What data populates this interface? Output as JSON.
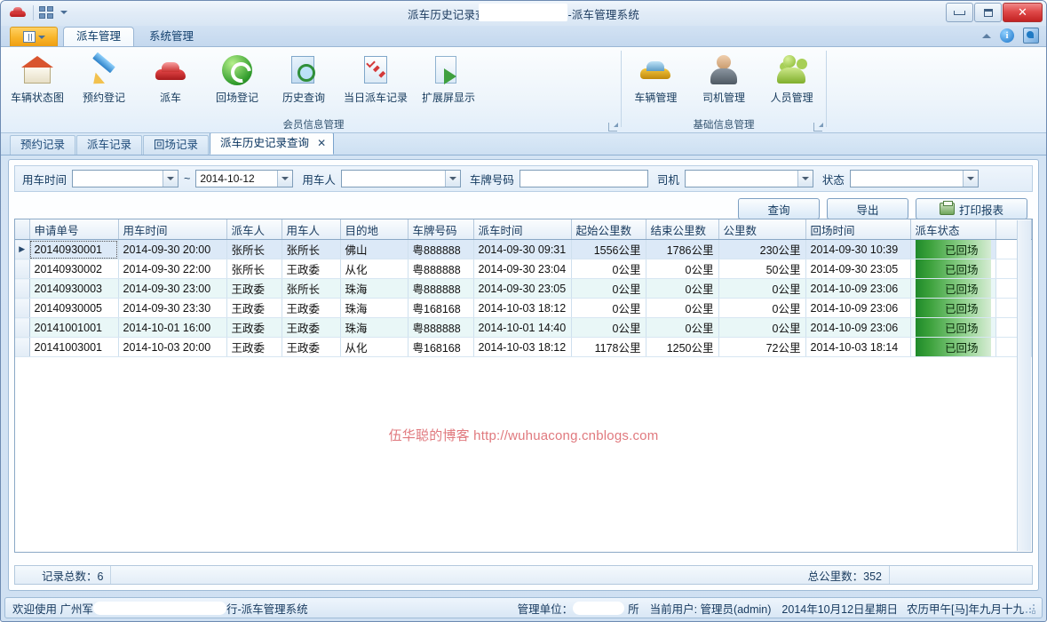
{
  "window": {
    "title": "派车历史记录查询 - 广州军区        行-派车管理系统",
    "title_prefix": "派车历史记录查询 - 广州军区",
    "title_suffix": "行-派车管理系统",
    "minimize_label": "最小化",
    "maximize_label": "最大化",
    "close_label": "✕"
  },
  "quick_access": {
    "app_icon": "car-icon",
    "customize_icon": "grid-icon"
  },
  "ribbon": {
    "app_button_label": "菜单",
    "tabs": [
      {
        "label": "派车管理",
        "active": true
      },
      {
        "label": "系统管理",
        "active": false
      }
    ],
    "right_icons": {
      "collapse": "chevron-up-icon",
      "info": "i",
      "help": "help-icon"
    },
    "groups": [
      {
        "title": "会员信息管理",
        "has_launcher": true,
        "items": [
          {
            "label": "车辆状态图",
            "icon": "house-icon"
          },
          {
            "label": "预约登记",
            "icon": "pencil-icon"
          },
          {
            "label": "派车",
            "icon": "red-car-icon"
          },
          {
            "label": "回场登记",
            "icon": "green-refresh-icon"
          },
          {
            "label": "历史查询",
            "icon": "magnifier-documents-icon"
          },
          {
            "label": "当日派车记录",
            "icon": "checklist-icon"
          },
          {
            "label": "扩展屏显示",
            "icon": "export-document-icon"
          }
        ]
      },
      {
        "title": "基础信息管理",
        "has_launcher": true,
        "items": [
          {
            "label": "车辆管理",
            "icon": "gold-car-icon"
          },
          {
            "label": "司机管理",
            "icon": "person-icon"
          },
          {
            "label": "人员管理",
            "icon": "people-icon"
          }
        ]
      }
    ]
  },
  "doc_tabs": [
    {
      "label": "预约记录",
      "active": false,
      "closable": false
    },
    {
      "label": "派车记录",
      "active": false,
      "closable": false
    },
    {
      "label": "回场记录",
      "active": false,
      "closable": false
    },
    {
      "label": "派车历史记录查询",
      "active": true,
      "closable": true,
      "close_glyph": "✕"
    }
  ],
  "filters": {
    "use_time_label": "用车时间",
    "use_time_from": "",
    "use_time_from_placeholder": "",
    "range_separator": "~",
    "use_time_to": "2014-10-12",
    "user_label": "用车人",
    "user_value": "",
    "plate_label": "车牌号码",
    "plate_value": "",
    "driver_label": "司机",
    "driver_value": "",
    "status_label": "状态",
    "status_value": ""
  },
  "actions": {
    "query": "查询",
    "export": "导出",
    "print": "打印报表",
    "print_icon": "printer-icon"
  },
  "grid": {
    "columns": [
      "申请单号",
      "用车时间",
      "派车人",
      "用车人",
      "目的地",
      "车牌号码",
      "派车时间",
      "起始公里数",
      "结束公里数",
      "公里数",
      "回场时间",
      "派车状态"
    ],
    "rows": [
      {
        "selected": true,
        "indicator": "▶",
        "申请单号": "20140930001",
        "用车时间": "2014-09-30 20:00",
        "派车人": "张所长",
        "用车人": "张所长",
        "目的地": "佛山",
        "车牌号码": "粤888888",
        "派车时间": "2014-09-30 09:31",
        "起始公里数": "1556公里",
        "结束公里数": "1786公里",
        "公里数": "230公里",
        "回场时间": "2014-09-30 10:39",
        "派车状态": "已回场"
      },
      {
        "selected": false,
        "indicator": "",
        "申请单号": "20140930002",
        "用车时间": "2014-09-30 22:00",
        "派车人": "张所长",
        "用车人": "王政委",
        "目的地": "从化",
        "车牌号码": "粤888888",
        "派车时间": "2014-09-30 23:04",
        "起始公里数": "0公里",
        "结束公里数": "0公里",
        "公里数": "50公里",
        "回场时间": "2014-09-30 23:05",
        "派车状态": "已回场"
      },
      {
        "selected": false,
        "indicator": "",
        "申请单号": "20140930003",
        "用车时间": "2014-09-30 23:00",
        "派车人": "王政委",
        "用车人": "张所长",
        "目的地": "珠海",
        "车牌号码": "粤888888",
        "派车时间": "2014-09-30 23:05",
        "起始公里数": "0公里",
        "结束公里数": "0公里",
        "公里数": "0公里",
        "回场时间": "2014-10-09 23:06",
        "派车状态": "已回场"
      },
      {
        "selected": false,
        "indicator": "",
        "申请单号": "20140930005",
        "用车时间": "2014-09-30 23:30",
        "派车人": "王政委",
        "用车人": "王政委",
        "目的地": "珠海",
        "车牌号码": "粤168168",
        "派车时间": "2014-10-03 18:12",
        "起始公里数": "0公里",
        "结束公里数": "0公里",
        "公里数": "0公里",
        "回场时间": "2014-10-09 23:06",
        "派车状态": "已回场"
      },
      {
        "selected": false,
        "indicator": "",
        "申请单号": "20141001001",
        "用车时间": "2014-10-01 16:00",
        "派车人": "王政委",
        "用车人": "王政委",
        "目的地": "珠海",
        "车牌号码": "粤888888",
        "派车时间": "2014-10-01 14:40",
        "起始公里数": "0公里",
        "结束公里数": "0公里",
        "公里数": "0公里",
        "回场时间": "2014-10-09 23:06",
        "派车状态": "已回场"
      },
      {
        "selected": false,
        "indicator": "",
        "申请单号": "20141003001",
        "用车时间": "2014-10-03 20:00",
        "派车人": "王政委",
        "用车人": "王政委",
        "目的地": "从化",
        "车牌号码": "粤168168",
        "派车时间": "2014-10-03 18:12",
        "起始公里数": "1178公里",
        "结束公里数": "1250公里",
        "公里数": "72公里",
        "回场时间": "2014-10-03 18:14",
        "派车状态": "已回场"
      }
    ]
  },
  "watermark": "伍华聪的博客 http://wuhuacong.cnblogs.com",
  "summary": {
    "record_total": "记录总数：6",
    "km_total": "总公里数：352"
  },
  "statusbar": {
    "welcome_prefix": "欢迎使用 广州军",
    "welcome_suffix": "行-派车管理系统",
    "unit_label": "管理单位：",
    "unit_suffix": "所",
    "current_user": "当前用户: 管理员(admin)",
    "date": "2014年10月12日星期日",
    "lunar": "农历甲午[马]年九月十九"
  },
  "colors": {
    "accent": "#1f8a2a",
    "title_blue": "#16395e",
    "close_red": "#c22222",
    "watermark_red": "#e0797e"
  }
}
